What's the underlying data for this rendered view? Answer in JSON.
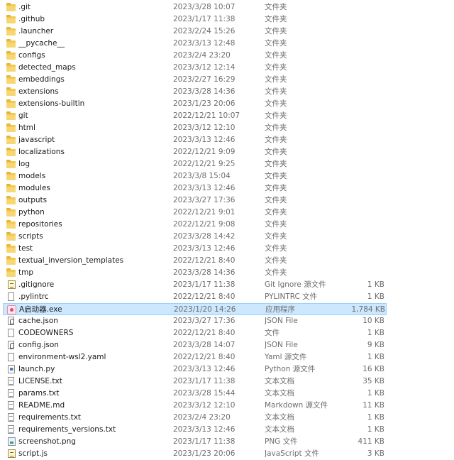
{
  "colors": {
    "selection_background": "#cce8ff",
    "selection_border": "#99d1ff",
    "folder": "#f2c94c",
    "secondary_text": "#6d6d6d"
  },
  "rows": [
    {
      "icon": "folder-icon",
      "name": ".git",
      "date": "2023/3/28 10:07",
      "type": "文件夹",
      "size": ""
    },
    {
      "icon": "folder-icon",
      "name": ".github",
      "date": "2023/1/17 11:38",
      "type": "文件夹",
      "size": ""
    },
    {
      "icon": "folder-icon",
      "name": ".launcher",
      "date": "2023/2/24 15:26",
      "type": "文件夹",
      "size": ""
    },
    {
      "icon": "folder-icon",
      "name": "__pycache__",
      "date": "2023/3/13 12:48",
      "type": "文件夹",
      "size": ""
    },
    {
      "icon": "folder-icon",
      "name": "configs",
      "date": "2023/2/4 23:20",
      "type": "文件夹",
      "size": ""
    },
    {
      "icon": "folder-icon",
      "name": "detected_maps",
      "date": "2023/3/12 12:14",
      "type": "文件夹",
      "size": ""
    },
    {
      "icon": "folder-icon",
      "name": "embeddings",
      "date": "2023/2/27 16:29",
      "type": "文件夹",
      "size": ""
    },
    {
      "icon": "folder-icon",
      "name": "extensions",
      "date": "2023/3/28 14:36",
      "type": "文件夹",
      "size": ""
    },
    {
      "icon": "folder-icon",
      "name": "extensions-builtin",
      "date": "2023/1/23 20:06",
      "type": "文件夹",
      "size": ""
    },
    {
      "icon": "folder-icon",
      "name": "git",
      "date": "2022/12/21 10:07",
      "type": "文件夹",
      "size": ""
    },
    {
      "icon": "folder-icon",
      "name": "html",
      "date": "2023/3/12 12:10",
      "type": "文件夹",
      "size": ""
    },
    {
      "icon": "folder-icon",
      "name": "javascript",
      "date": "2023/3/13 12:46",
      "type": "文件夹",
      "size": ""
    },
    {
      "icon": "folder-icon",
      "name": "localizations",
      "date": "2022/12/21 9:09",
      "type": "文件夹",
      "size": ""
    },
    {
      "icon": "folder-icon",
      "name": "log",
      "date": "2022/12/21 9:25",
      "type": "文件夹",
      "size": ""
    },
    {
      "icon": "folder-icon",
      "name": "models",
      "date": "2023/3/8 15:04",
      "type": "文件夹",
      "size": ""
    },
    {
      "icon": "folder-icon",
      "name": "modules",
      "date": "2023/3/13 12:46",
      "type": "文件夹",
      "size": ""
    },
    {
      "icon": "folder-icon",
      "name": "outputs",
      "date": "2023/3/27 17:36",
      "type": "文件夹",
      "size": ""
    },
    {
      "icon": "folder-icon",
      "name": "python",
      "date": "2022/12/21 9:01",
      "type": "文件夹",
      "size": ""
    },
    {
      "icon": "folder-icon",
      "name": "repositories",
      "date": "2022/12/21 9:08",
      "type": "文件夹",
      "size": ""
    },
    {
      "icon": "folder-icon",
      "name": "scripts",
      "date": "2023/3/28 14:42",
      "type": "文件夹",
      "size": ""
    },
    {
      "icon": "folder-icon",
      "name": "test",
      "date": "2023/3/13 12:46",
      "type": "文件夹",
      "size": ""
    },
    {
      "icon": "folder-icon",
      "name": "textual_inversion_templates",
      "date": "2022/12/21 8:40",
      "type": "文件夹",
      "size": ""
    },
    {
      "icon": "folder-icon",
      "name": "tmp",
      "date": "2023/3/28 14:36",
      "type": "文件夹",
      "size": ""
    },
    {
      "icon": "script-file-icon",
      "name": ".gitignore",
      "date": "2023/1/17 11:38",
      "type": "Git Ignore 源文件",
      "size": "1 KB"
    },
    {
      "icon": "blank-file-icon",
      "name": ".pylintrc",
      "date": "2022/12/21 8:40",
      "type": "PYLINTRC 文件",
      "size": "1 KB"
    },
    {
      "icon": "app-launcher-icon",
      "name": "A启动器.exe",
      "date": "2023/1/20 14:26",
      "type": "应用程序",
      "size": "1,784 KB",
      "selected": true
    },
    {
      "icon": "json-file-icon",
      "name": "cache.json",
      "date": "2023/3/27 17:36",
      "type": "JSON File",
      "size": "10 KB"
    },
    {
      "icon": "blank-file-icon",
      "name": "CODEOWNERS",
      "date": "2022/12/21 8:40",
      "type": "文件",
      "size": "1 KB"
    },
    {
      "icon": "json-file-icon",
      "name": "config.json",
      "date": "2023/3/28 14:07",
      "type": "JSON File",
      "size": "9 KB"
    },
    {
      "icon": "blank-file-icon",
      "name": "environment-wsl2.yaml",
      "date": "2022/12/21 8:40",
      "type": "Yaml 源文件",
      "size": "1 KB"
    },
    {
      "icon": "python-file-icon",
      "name": "launch.py",
      "date": "2023/3/13 12:46",
      "type": "Python 源文件",
      "size": "16 KB"
    },
    {
      "icon": "text-file-icon",
      "name": "LICENSE.txt",
      "date": "2023/1/17 11:38",
      "type": "文本文档",
      "size": "35 KB"
    },
    {
      "icon": "text-file-icon",
      "name": "params.txt",
      "date": "2023/3/28 15:44",
      "type": "文本文档",
      "size": "1 KB"
    },
    {
      "icon": "markdown-file-icon",
      "name": "README.md",
      "date": "2023/3/12 12:10",
      "type": "Markdown 源文件",
      "size": "11 KB"
    },
    {
      "icon": "text-file-icon",
      "name": "requirements.txt",
      "date": "2023/2/4 23:20",
      "type": "文本文档",
      "size": "1 KB"
    },
    {
      "icon": "text-file-icon",
      "name": "requirements_versions.txt",
      "date": "2023/3/13 12:46",
      "type": "文本文档",
      "size": "1 KB"
    },
    {
      "icon": "image-file-icon",
      "name": "screenshot.png",
      "date": "2023/1/17 11:38",
      "type": "PNG 文件",
      "size": "411 KB"
    },
    {
      "icon": "script-file-icon",
      "name": "script.js",
      "date": "2023/1/23 20:06",
      "type": "JavaScript 文件",
      "size": "3 KB"
    }
  ]
}
